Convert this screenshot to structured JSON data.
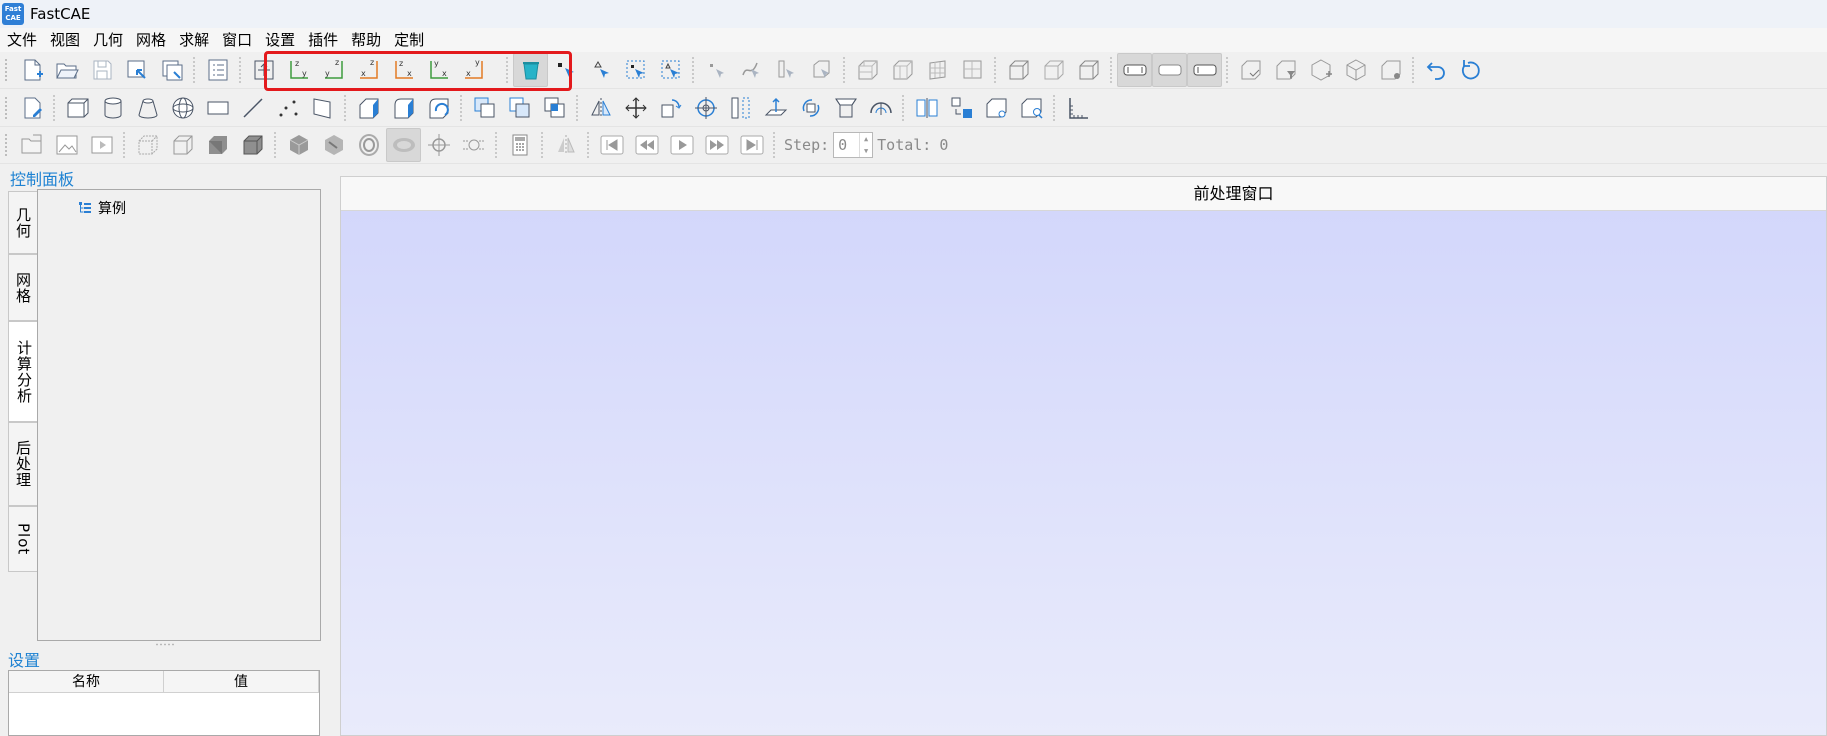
{
  "app": {
    "title": "FastCAE",
    "logo_text": "Fast CAE"
  },
  "menu": [
    "文件",
    "视图",
    "几何",
    "网格",
    "求解",
    "窗口",
    "设置",
    "插件",
    "帮助",
    "定制"
  ],
  "toolbar": {
    "step_label": "Step:",
    "step_value": "0",
    "total_label": "Total:",
    "total_value": "0"
  },
  "left_panel": {
    "title": "控制面板",
    "tabs": [
      "几何",
      "网格",
      "计算分析",
      "后处理",
      "Plot"
    ],
    "active_tab": "计算分析",
    "tree_root": "算例"
  },
  "settings": {
    "title": "设置",
    "columns": [
      "名称",
      "值"
    ]
  },
  "viewport": {
    "title": "前处理窗口"
  },
  "colors": {
    "accent": "#1e82d2",
    "highlight": "#e3191c",
    "canvas_top": "#d3d7fb",
    "canvas_bottom": "#e9ebfb"
  }
}
